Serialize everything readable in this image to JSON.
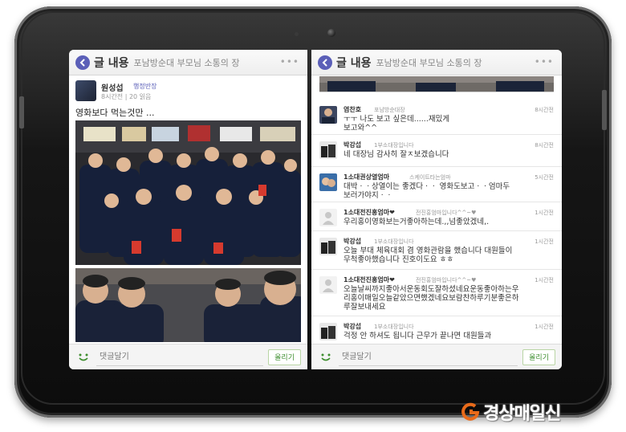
{
  "left_pane": {
    "header": {
      "title": "글 내용",
      "subtitle": "포남방순대 부모님 소통의 장",
      "more": "•••"
    },
    "post": {
      "author": "원성섭",
      "role": "행정반장",
      "meta": "8시간전 | 20 읽음",
      "text": "영화보다 먹는것만 ..."
    },
    "comment_bar": {
      "placeholder": "댓글달기",
      "button": "올리기"
    }
  },
  "right_pane": {
    "header": {
      "title": "글 내용",
      "subtitle": "포남방순대 부모님 소통의 장",
      "more": "•••"
    },
    "comments": [
      {
        "name": "염찬호",
        "role": "포남방순대장",
        "time": "8시간전",
        "text": "ㅜㅜ 나도 보고 싶은데......재밌게\n보고와^^"
      },
      {
        "name": "박강섭",
        "role": "1부소대장입니다",
        "time": "8시간전",
        "text": "네 대장님 감사히 잘ㅈ보겠습니다"
      },
      {
        "name": "1소대권상열엄마",
        "role": "스케이트타는엄마",
        "time": "5시간전",
        "text": "대박ㆍㆍ상열이는 좋겠다ㆍㆍ 영화도보고ㆍㆍ엄마두\n보러가야지ㆍㆍ"
      },
      {
        "name": "1소대전진홍엄마❤",
        "role": "전진홍엄마입니다^^~♥",
        "time": "1시간전",
        "text": "우리홍이영화보는거좋아하는데.,,넘좋았겠네,."
      },
      {
        "name": "박강섭",
        "role": "1부소대장입니다",
        "time": "1시간전",
        "text": "오늘 부대 체육대회 겸  영화관람을 했습니다  대원들이\n무척좋아했습니다 진호이도요 ㅎㅎ"
      },
      {
        "name": "1소대전진홍엄마❤",
        "role": "전진홍엄마입니다^^~♥",
        "time": "1시간전",
        "text": "오늘날씨까지좋아서운동회도잘하셨네요운동좋아하는우\n리홍이매일오늘같았으면했겠네요보람찬하루기분좋은하\n루잘보내세요"
      },
      {
        "name": "박강섭",
        "role": "1부소대장입니다",
        "time": "1시간전",
        "text": "걱정 안 하셔도 됩니다  근무가  끝나면  대원들과"
      }
    ],
    "comment_bar": {
      "placeholder": "댓글달기",
      "button": "올리기"
    }
  },
  "watermark": {
    "text": "경상매일신"
  }
}
